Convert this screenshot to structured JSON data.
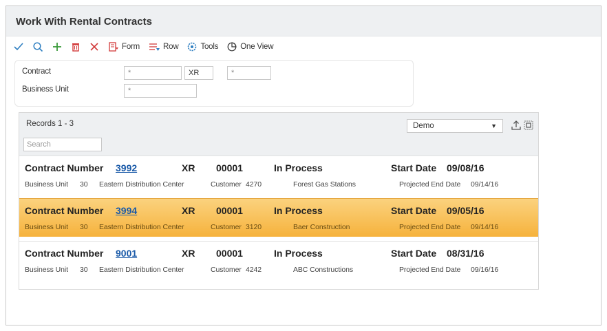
{
  "title": "Work With Rental Contracts",
  "toolbar": {
    "form_label": "Form",
    "row_label": "Row",
    "tools_label": "Tools",
    "oneview_label": "One View"
  },
  "filters": {
    "contract_label": "Contract",
    "contract_value": "*",
    "contract_type_value": "XR",
    "contract_company_value": "*",
    "business_unit_label": "Business Unit",
    "business_unit_value": "*"
  },
  "grid": {
    "records_text": "Records 1 - 3",
    "search_placeholder": "Search",
    "view_select_value": "Demo",
    "rows": [
      {
        "contract_label": "Contract Number",
        "contract_number": "3992",
        "type": "XR",
        "company": "00001",
        "status": "In Process",
        "start_label": "Start Date",
        "start_date": "09/08/16",
        "bu_label": "Business Unit",
        "bu_value": "30",
        "bu_name": "Eastern Distribution Center",
        "customer_label": "Customer",
        "customer_value": "4270",
        "customer_name": "Forest Gas Stations",
        "end_label": "Projected End Date",
        "end_date": "09/14/16"
      },
      {
        "contract_label": "Contract Number",
        "contract_number": "3994",
        "type": "XR",
        "company": "00001",
        "status": "In Process",
        "start_label": "Start Date",
        "start_date": "09/05/16",
        "bu_label": "Business Unit",
        "bu_value": "30",
        "bu_name": "Eastern Distribution Center",
        "customer_label": "Customer",
        "customer_value": "3120",
        "customer_name": "Baer Construction",
        "end_label": "Projected End Date",
        "end_date": "09/14/16"
      },
      {
        "contract_label": "Contract Number",
        "contract_number": "9001",
        "type": "XR",
        "company": "00001",
        "status": "In Process",
        "start_label": "Start Date",
        "start_date": "08/31/16",
        "bu_label": "Business Unit",
        "bu_value": "30",
        "bu_name": "Eastern Distribution Center",
        "customer_label": "Customer",
        "customer_value": "4242",
        "customer_name": "ABC Constructions",
        "end_label": "Projected End Date",
        "end_date": "09/16/16"
      }
    ]
  },
  "colors": {
    "accent_green": "#3a9a3a",
    "accent_blue": "#2f7fc1",
    "accent_red": "#d23a3a",
    "selected_row": "#f6b23c",
    "link": "#1a5aa8"
  }
}
